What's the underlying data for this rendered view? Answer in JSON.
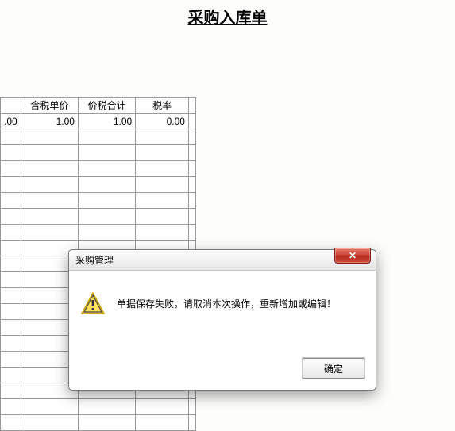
{
  "page": {
    "title": "采购入库单"
  },
  "table": {
    "headers": [
      "含税单价",
      "价税合计",
      "税率"
    ],
    "first_cell_partial": ".00",
    "row1": {
      "unit_price": "1.00",
      "total": "1.00",
      "tax_rate": "0.00"
    }
  },
  "dialog": {
    "title": "采购管理",
    "message": "单据保存失败，请取消本次操作，重新增加或编辑！",
    "ok": "确定",
    "close_glyph": "✕"
  }
}
